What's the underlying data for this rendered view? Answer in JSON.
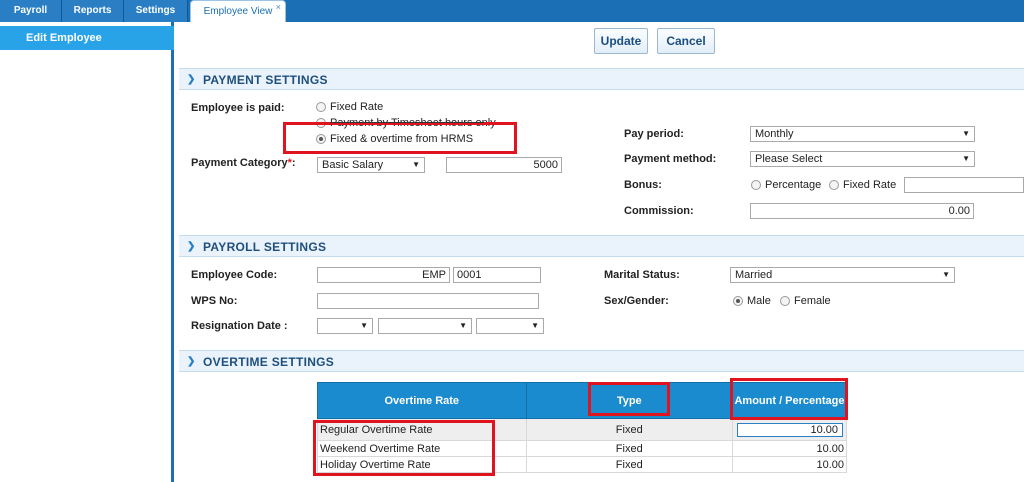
{
  "tabs": [
    "Payroll",
    "Reports",
    "Settings",
    "Employee View"
  ],
  "tab_close": "×",
  "sidebar": {
    "item": "Edit Employee"
  },
  "actions": {
    "update": "Update",
    "cancel": "Cancel"
  },
  "payment": {
    "header": "PAYMENT SETTINGS",
    "paid_label": "Employee is paid:",
    "options": [
      "Fixed Rate",
      "Payment by Timesheet hours only",
      "Fixed & overtime from HRMS"
    ],
    "category_label": "Payment Category",
    "required": "*",
    "colon": ":",
    "category_value": "Basic Salary",
    "category_amount": "5000",
    "pay_period_label": "Pay period:",
    "pay_period_value": "Monthly",
    "method_label": "Payment method:",
    "method_value": "Please Select",
    "bonus_label": "Bonus:",
    "bonus_options": [
      "Percentage",
      "Fixed Rate"
    ],
    "commission_label": "Commission:",
    "commission_value": "0.00"
  },
  "payroll": {
    "header": "PAYROLL SETTINGS",
    "code_label": "Employee Code:",
    "code_prefix": "EMP",
    "code_number": "0001",
    "wps_label": "WPS No:",
    "resign_label": "Resignation Date :",
    "marital_label": "Marital Status:",
    "marital_value": "Married",
    "gender_label": "Sex/Gender:",
    "gender_options": [
      "Male",
      "Female"
    ]
  },
  "overtime": {
    "header": "OVERTIME SETTINGS",
    "columns": [
      "Overtime Rate",
      "Type",
      "Amount / Percentage"
    ],
    "rows": [
      {
        "name": "Regular Overtime Rate",
        "type": "Fixed",
        "amount": "10.00"
      },
      {
        "name": "Weekend Overtime Rate",
        "type": "Fixed",
        "amount": "10.00"
      },
      {
        "name": "Holiday Overtime Rate",
        "type": "Fixed",
        "amount": "10.00"
      }
    ]
  },
  "colors": {
    "primary": "#1a6fb5",
    "accent": "#29a3e8",
    "highlight": "#e0141e",
    "table_header": "#1b8bd0"
  }
}
